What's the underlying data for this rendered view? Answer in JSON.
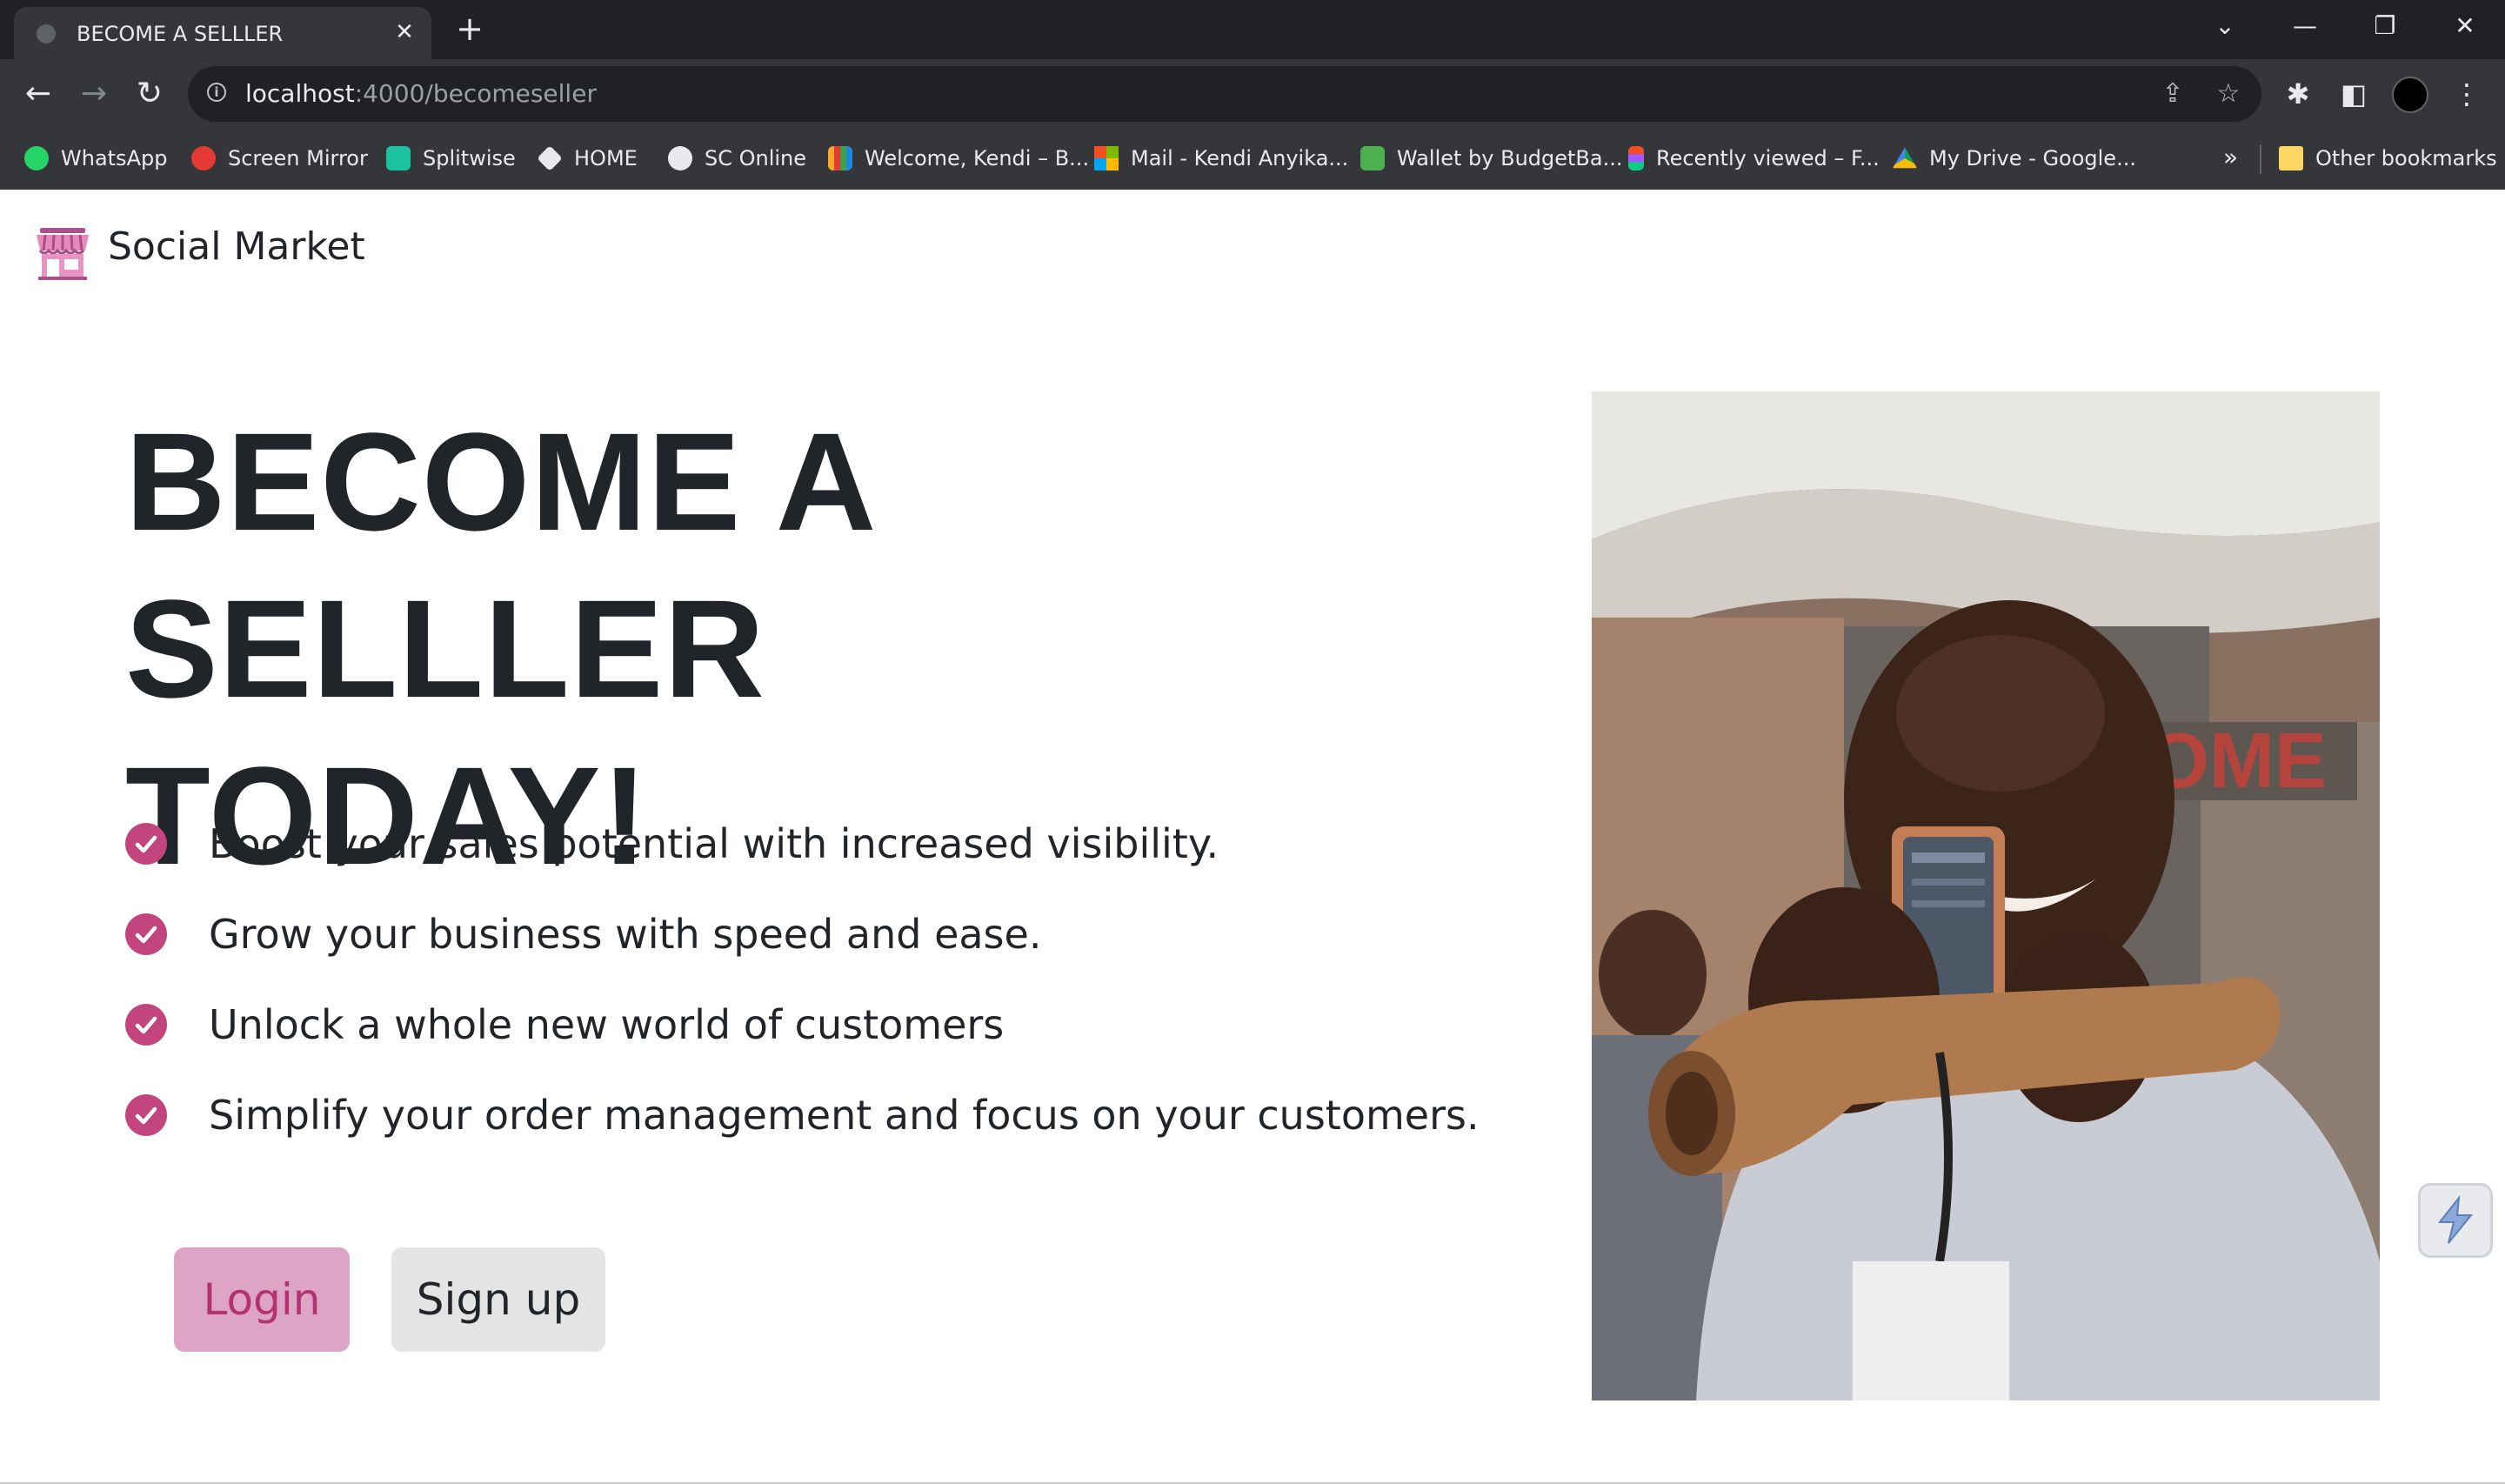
{
  "browser": {
    "tab_title": "BECOME A SELLLER",
    "tab_close": "✕",
    "new_tab": "+",
    "url_host": "localhost",
    "url_path": ":4000/becomeseller",
    "bookmarks": [
      {
        "label": "WhatsApp",
        "color": "#25d366"
      },
      {
        "label": "Screen Mirror",
        "color": "#e53935"
      },
      {
        "label": "Splitwise",
        "color": "#e8eaed"
      },
      {
        "label": "HOME",
        "color": "#e8eaed"
      },
      {
        "label": "SC Online",
        "color": "#e8eaed"
      },
      {
        "label": "Welcome, Kendi – B...",
        "color": "#f9a825"
      },
      {
        "label": "Mail - Kendi Anyika...",
        "color": "#0078d4"
      },
      {
        "label": "Wallet by BudgetBa...",
        "color": "#4caf50"
      },
      {
        "label": "Recently viewed – F...",
        "color": "#a259ff"
      },
      {
        "label": "My Drive - Google...",
        "color": "#fbbc04"
      }
    ],
    "bookmarks_more": "»",
    "other_bookmarks": "Other bookmarks"
  },
  "header": {
    "brand": "Social Market"
  },
  "hero": {
    "headline_line1": "BECOME A SELLLER",
    "headline_line2": "TODAY!",
    "features": [
      "Boost your sales potential with increased visibility.",
      "Grow your business with speed and ease.",
      "Unlock a whole new world of customers",
      "Simplify your order management and focus on your customers."
    ],
    "login_label": "Login",
    "signup_label": "Sign up"
  },
  "colors": {
    "accent": "#c2457e",
    "login_bg": "#dea4c6",
    "text": "#212529"
  }
}
